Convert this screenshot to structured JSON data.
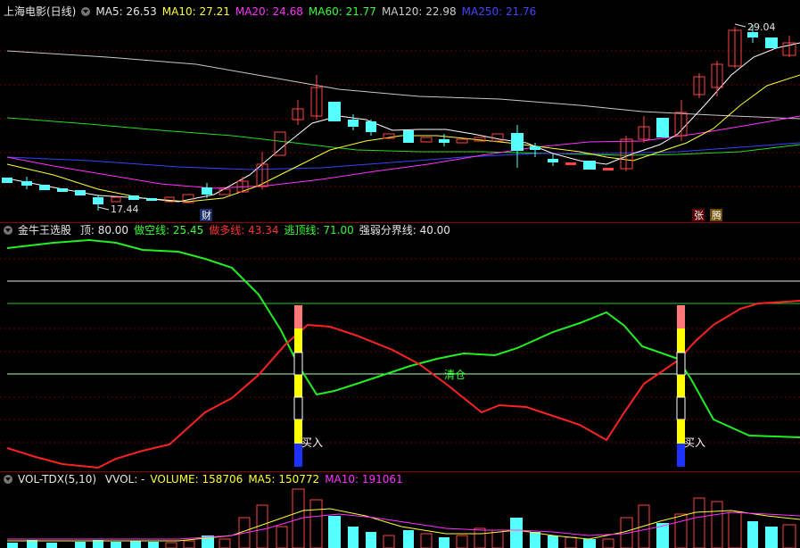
{
  "header1": {
    "title": "上海电影(日线)",
    "ma": [
      {
        "text": "MA5: 26.53",
        "color": "#e8e8e8"
      },
      {
        "text": "MA10: 27.21",
        "color": "#ffff33"
      },
      {
        "text": "MA20: 24.68",
        "color": "#ff33ff"
      },
      {
        "text": "MA60: 21.77",
        "color": "#33ff33"
      },
      {
        "text": "MA120: 22.98",
        "color": "#cccccc"
      },
      {
        "text": "MA250: 21.76",
        "color": "#4444ff"
      }
    ]
  },
  "price_panel": {
    "high_label": "29.04",
    "low_label": "17.44",
    "badge_cai": "财",
    "badge_zhang": "张",
    "badge_teng": "腾"
  },
  "header2": {
    "title": "金牛王选股",
    "items": [
      {
        "text": "顶: 80.00",
        "color": "#e8e8e8"
      },
      {
        "text": "做空线: 25.45",
        "color": "#33ff33"
      },
      {
        "text": "做多线: 43.34",
        "color": "#ff3333"
      },
      {
        "text": "逃顶线: 71.00",
        "color": "#33ff33"
      },
      {
        "text": "强弱分界线: 40.00",
        "color": "#e8e8e8"
      }
    ]
  },
  "indicator_panel": {
    "buy_label_1": "买入",
    "buy_label_2": "买入",
    "clear_label": "清仓"
  },
  "header3": {
    "title": "VOL-TDX(5,10)",
    "items": [
      {
        "text": "VVOL: -",
        "color": "#e8e8e8"
      },
      {
        "text": "VOLUME: 158706",
        "color": "#ffff33"
      },
      {
        "text": "MA5: 150772",
        "color": "#ffff33"
      },
      {
        "text": "MA10: 191061",
        "color": "#ff33ff"
      }
    ]
  },
  "chart_data": {
    "type": "candlestick",
    "panels": [
      {
        "name": "price",
        "series": [
          {
            "name": "MA5",
            "value": 26.53,
            "color": "#ffffff"
          },
          {
            "name": "MA10",
            "value": 27.21,
            "color": "#ffff00"
          },
          {
            "name": "MA20",
            "value": 24.68,
            "color": "#ff00ff"
          },
          {
            "name": "MA60",
            "value": 21.77,
            "color": "#00ff00"
          },
          {
            "name": "MA120",
            "value": 22.98,
            "color": "#cccccc"
          },
          {
            "name": "MA250",
            "value": 21.76,
            "color": "#3333ff"
          }
        ],
        "annotations": [
          "29.04",
          "17.44"
        ]
      },
      {
        "name": "indicator",
        "lines": [
          {
            "label": "顶: 80.00",
            "value": 80.0
          },
          {
            "label": "做空线: 25.45",
            "value": 25.45
          },
          {
            "label": "做多线: 43.34",
            "value": 43.34
          },
          {
            "label": "逃顶线: 71.00",
            "value": 71.0
          },
          {
            "label": "强弱分界线: 40.00",
            "value": 40.0
          }
        ],
        "annotations": [
          "买入",
          "清仓",
          "买入"
        ]
      },
      {
        "name": "volume",
        "series": [
          {
            "name": "VVOL",
            "value": "-"
          },
          {
            "name": "VOLUME",
            "value": 158706
          },
          {
            "name": "MA5",
            "value": 150772
          },
          {
            "name": "MA10",
            "value": 191061
          }
        ]
      }
    ]
  }
}
